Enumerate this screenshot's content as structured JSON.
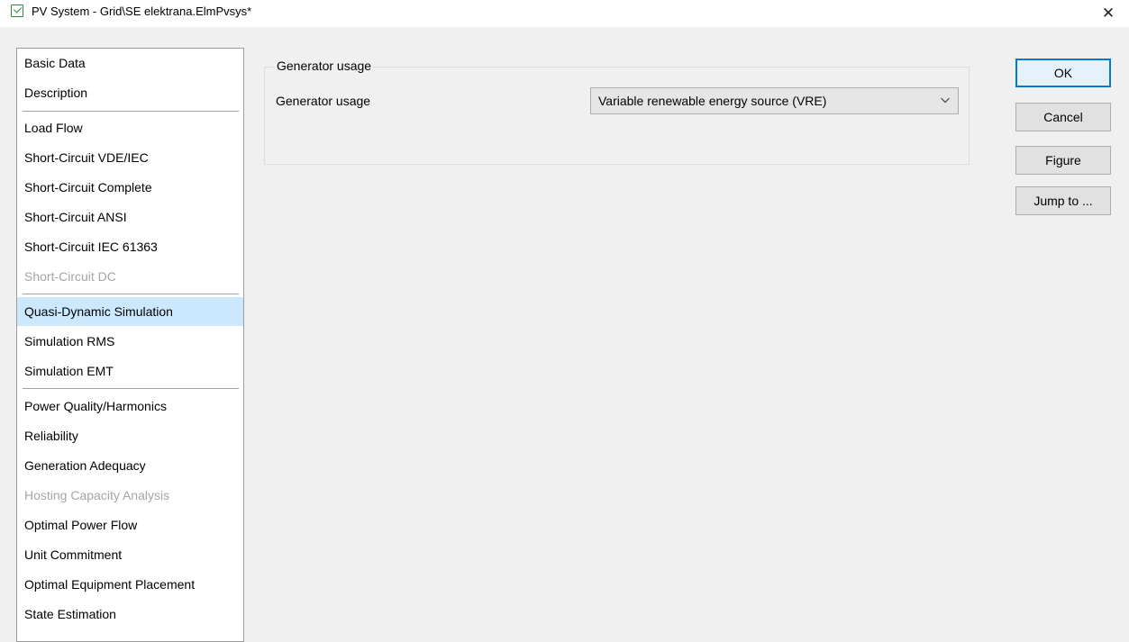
{
  "window": {
    "title": "PV System - Grid\\SE elektrana.ElmPvsys*",
    "close_glyph": "✕"
  },
  "sidebar": {
    "items": [
      {
        "label": "Basic Data",
        "state": "normal"
      },
      {
        "label": "Description",
        "state": "normal"
      },
      {
        "label": "Load Flow",
        "state": "normal"
      },
      {
        "label": "Short-Circuit VDE/IEC",
        "state": "normal"
      },
      {
        "label": "Short-Circuit Complete",
        "state": "normal"
      },
      {
        "label": "Short-Circuit ANSI",
        "state": "normal"
      },
      {
        "label": "Short-Circuit IEC 61363",
        "state": "normal"
      },
      {
        "label": "Short-Circuit DC",
        "state": "disabled"
      },
      {
        "label": "Quasi-Dynamic Simulation",
        "state": "selected"
      },
      {
        "label": "Simulation RMS",
        "state": "normal"
      },
      {
        "label": "Simulation EMT",
        "state": "normal"
      },
      {
        "label": "Power Quality/Harmonics",
        "state": "normal"
      },
      {
        "label": "Reliability",
        "state": "normal"
      },
      {
        "label": "Generation Adequacy",
        "state": "normal"
      },
      {
        "label": "Hosting Capacity Analysis",
        "state": "disabled"
      },
      {
        "label": "Optimal Power Flow",
        "state": "normal"
      },
      {
        "label": "Unit Commitment",
        "state": "normal"
      },
      {
        "label": "Optimal Equipment Placement",
        "state": "normal"
      },
      {
        "label": "State Estimation",
        "state": "normal"
      }
    ]
  },
  "main": {
    "group_title": "Generator usage",
    "field_label": "Generator usage",
    "select_value": "Variable renewable energy source (VRE)"
  },
  "buttons": {
    "ok": "OK",
    "cancel": "Cancel",
    "figure": "Figure",
    "jump_to": "Jump to ..."
  },
  "colors": {
    "selected_bg": "#cce8ff",
    "disabled_text": "#a5a5a5",
    "default_button_border": "#0078d7"
  }
}
